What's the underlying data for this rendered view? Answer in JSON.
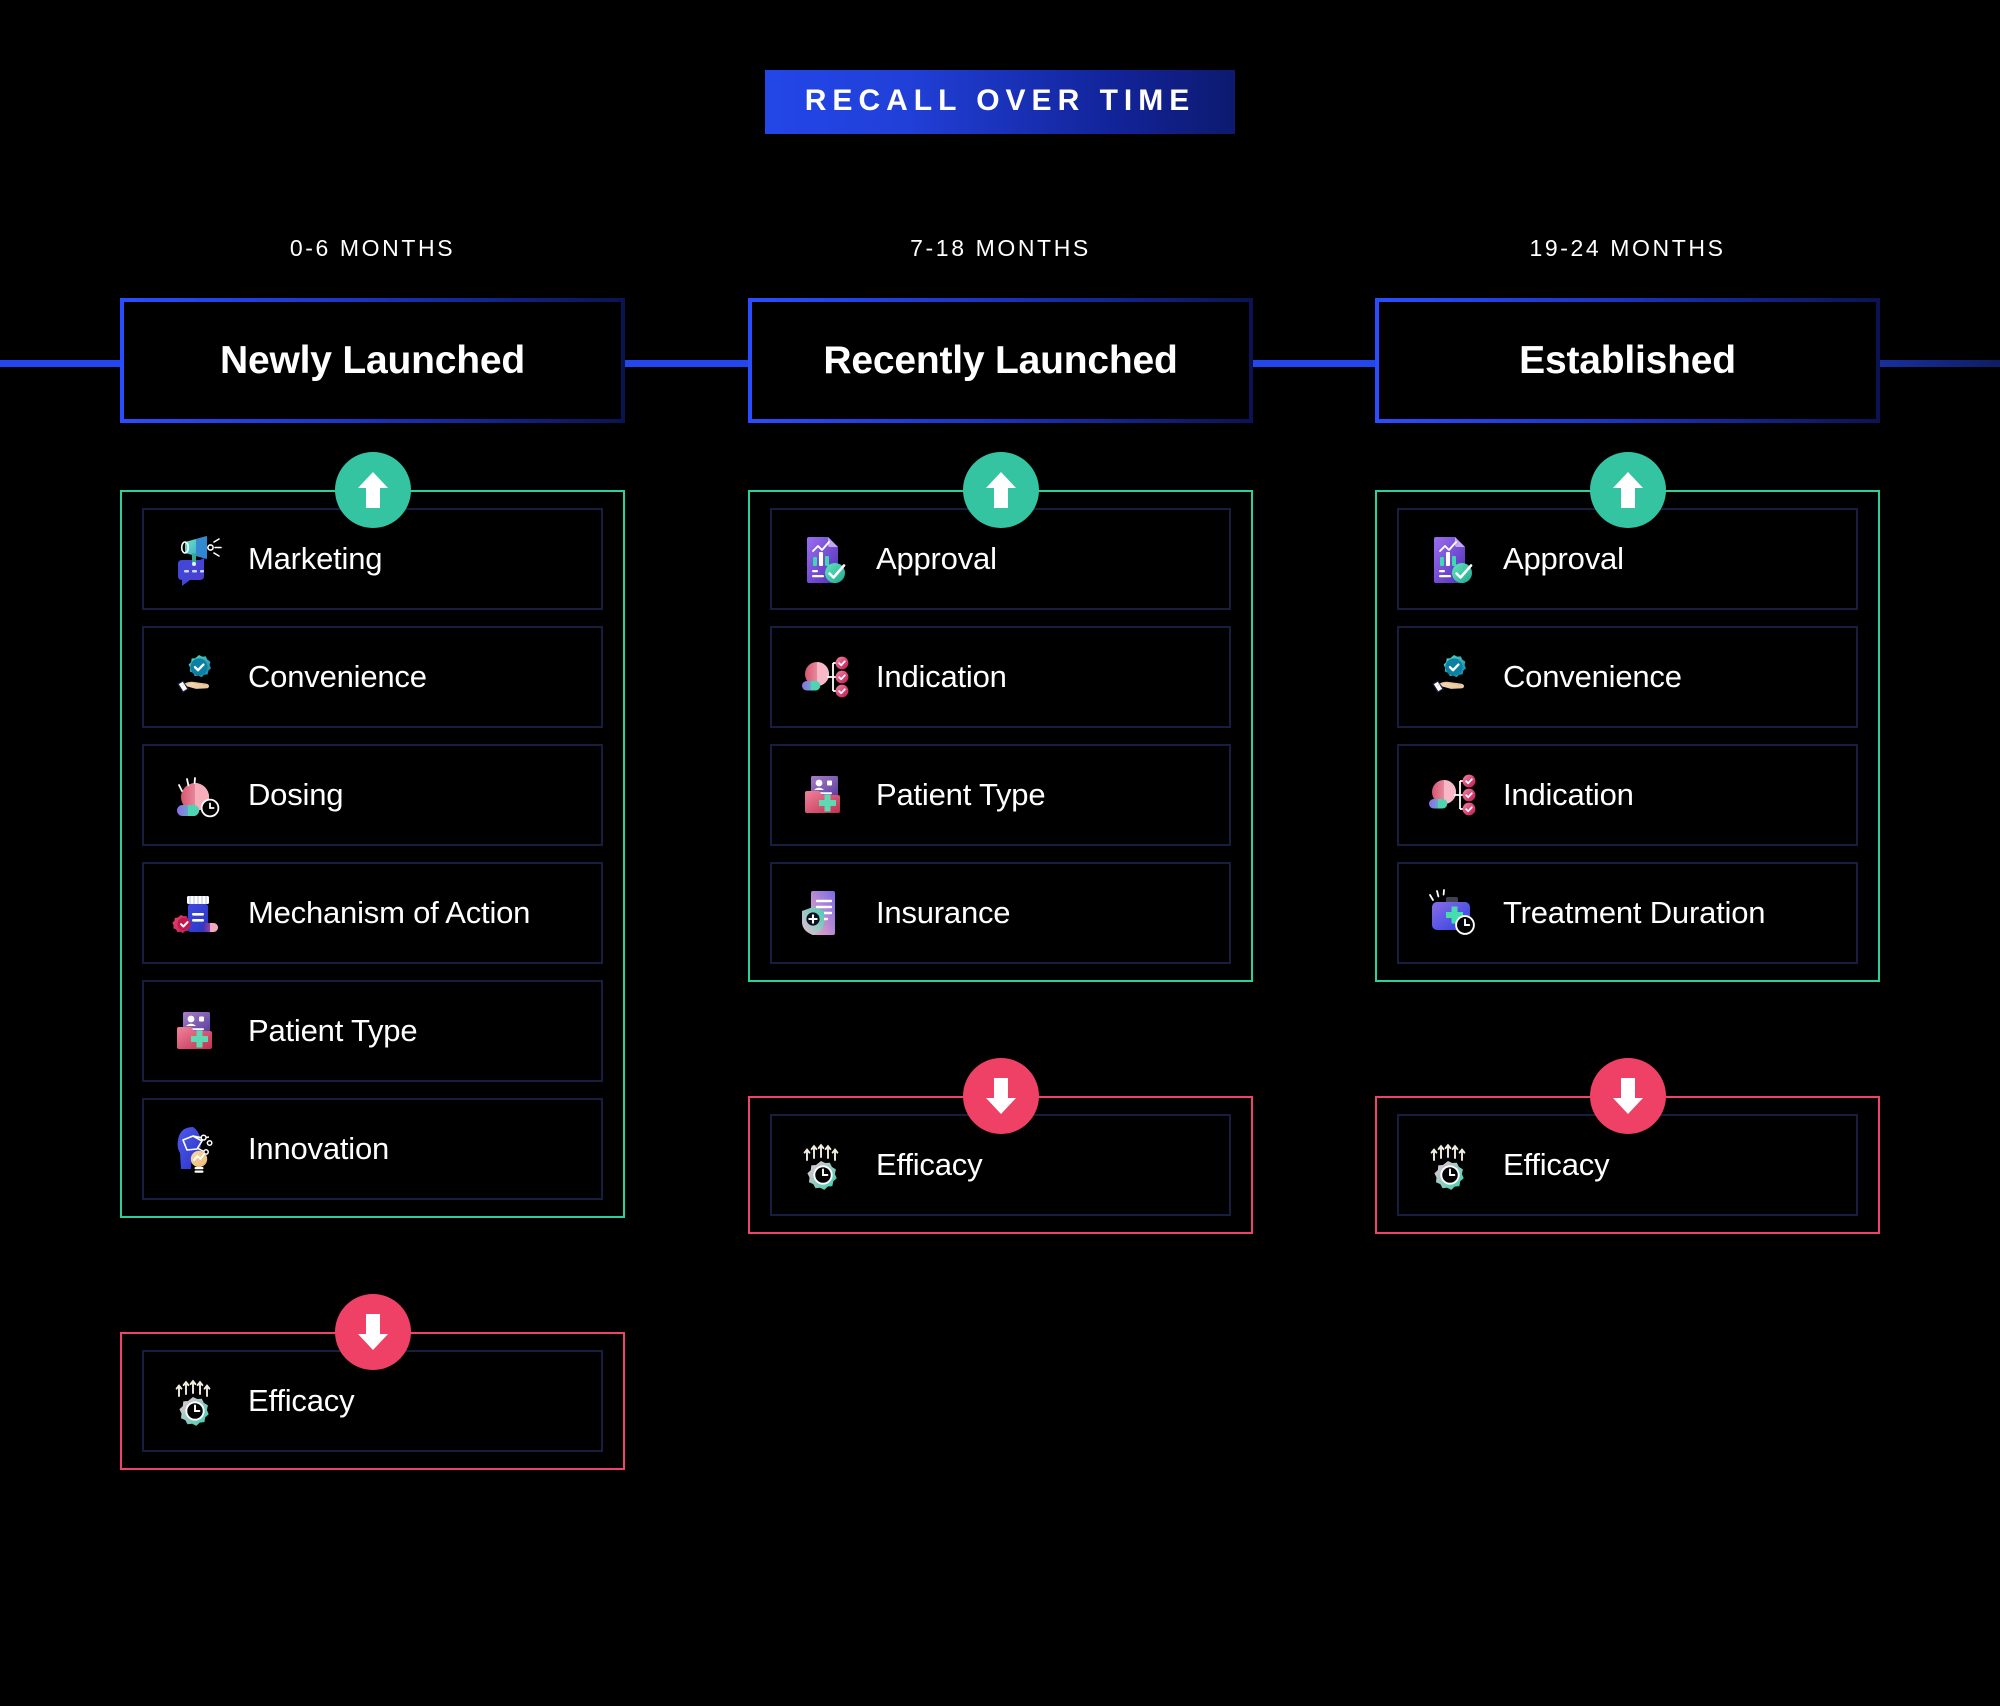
{
  "title": {
    "text": "RECALL OVER TIME"
  },
  "colors": {
    "background": "#000000",
    "title_gradient_start": "#2346e8",
    "title_gradient_end": "#0d1a70",
    "stage_border_blue": "#2347ef",
    "rail_blue": "#2347ef",
    "up_group_green": "#2ecf9e",
    "up_badge_green": "#35c4a2",
    "down_group_pink": "#f0436a",
    "down_badge_pink": "#ef4166",
    "card_border_navy": "#181e40",
    "text_white": "#ffffff"
  },
  "columns": [
    {
      "period": "0-6 MONTHS",
      "stage": "Newly Launched",
      "up_badge_icon": "arrow-up-icon",
      "down_badge_icon": "arrow-down-icon",
      "up_items": [
        {
          "label": "Marketing",
          "icon": "megaphone-icon"
        },
        {
          "label": "Convenience",
          "icon": "hand-gear-check-icon"
        },
        {
          "label": "Dosing",
          "icon": "pill-clock-icon"
        },
        {
          "label": "Mechanism of Action",
          "icon": "pill-bottle-gear-icon"
        },
        {
          "label": "Patient Type",
          "icon": "patient-folder-icon"
        },
        {
          "label": "Innovation",
          "icon": "head-lightbulb-icon"
        }
      ],
      "down_items": [
        {
          "label": "Efficacy",
          "icon": "gear-clock-arrows-icon"
        }
      ]
    },
    {
      "period": "7-18 MONTHS",
      "stage": "Recently Launched",
      "up_badge_icon": "arrow-up-icon",
      "down_badge_icon": "arrow-down-icon",
      "up_items": [
        {
          "label": "Approval",
          "icon": "document-chart-check-icon"
        },
        {
          "label": "Indication",
          "icon": "pill-checklist-icon"
        },
        {
          "label": "Patient Type",
          "icon": "patient-folder-icon"
        },
        {
          "label": "Insurance",
          "icon": "document-shield-icon"
        }
      ],
      "down_items": [
        {
          "label": "Efficacy",
          "icon": "gear-clock-arrows-icon"
        }
      ]
    },
    {
      "period": "19-24 MONTHS",
      "stage": "Established",
      "up_badge_icon": "arrow-up-icon",
      "down_badge_icon": "arrow-down-icon",
      "up_items": [
        {
          "label": "Approval",
          "icon": "document-chart-check-icon"
        },
        {
          "label": "Convenience",
          "icon": "hand-gear-check-icon"
        },
        {
          "label": "Indication",
          "icon": "pill-checklist-icon"
        },
        {
          "label": "Treatment Duration",
          "icon": "medical-bag-clock-icon"
        }
      ],
      "down_items": [
        {
          "label": "Efficacy",
          "icon": "gear-clock-arrows-icon"
        }
      ]
    }
  ]
}
